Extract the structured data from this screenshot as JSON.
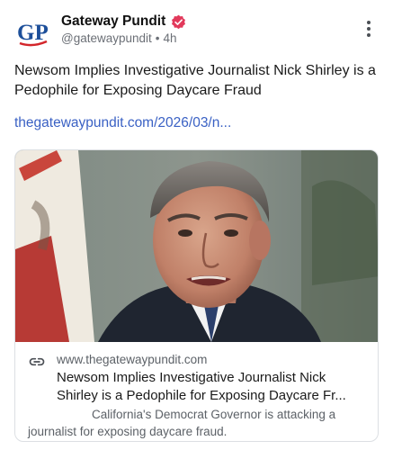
{
  "post": {
    "author_name": "Gateway Pundit",
    "handle": "@gatewaypundit",
    "separator": "•",
    "time": "4h",
    "avatar_text": "GP",
    "text": "Newsom Implies Investigative Journalist Nick Shirley is a Pedophile for Exposing Daycare Fraud",
    "link": "thegatewaypundit.com/2026/03/n..."
  },
  "card": {
    "domain": "www.thegatewaypundit.com",
    "title_line1": "Newsom Implies Investigative Journalist Nick",
    "title_line2": "Shirley is a Pedophile for Exposing Daycare Fr...",
    "description_line1": "California's Democrat Governor is attacking a",
    "description_line2": "journalist for exposing daycare fraud."
  },
  "icons": {
    "verified": "verified-badge-icon",
    "more": "more-vertical-icon",
    "link": "link-icon"
  },
  "colors": {
    "link": "#3a61c4",
    "verified": "#e2395b",
    "avatar_blue": "#1d4f9a",
    "avatar_red": "#d3262b",
    "muted": "#6b6f76"
  }
}
